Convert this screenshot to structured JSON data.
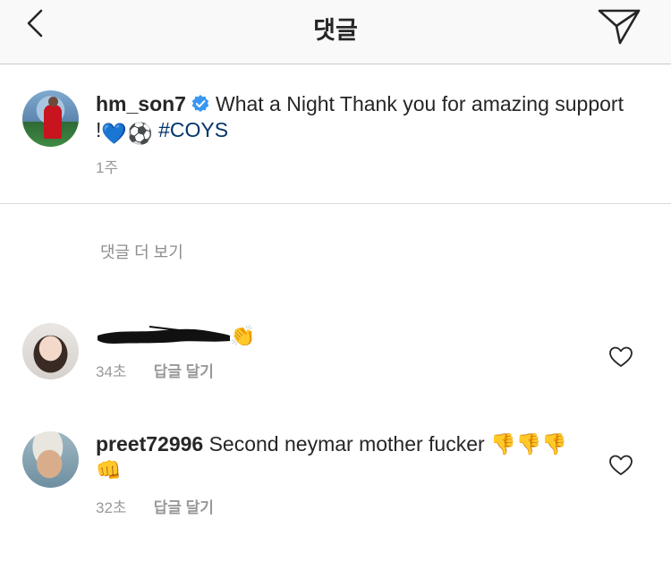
{
  "header": {
    "title": "댓글",
    "back_icon": "chevron-left-icon",
    "share_icon": "paper-plane-icon"
  },
  "caption": {
    "username": "hm_son7",
    "verified_icon": "verified-badge-icon",
    "text": "What a Night Thank you for amazing support !",
    "emojis": "💙⚽",
    "hashtag": "#COYS",
    "time": "1주"
  },
  "load_more": "댓글 더 보기",
  "comments": [
    {
      "username": "",
      "text": "👏",
      "time": "34초",
      "reply_label": "답글 달기",
      "like_icon": "heart-outline-icon"
    },
    {
      "username": "preet72996",
      "text": "Second neymar mother fucker 👎👎👎👊",
      "time": "32초",
      "reply_label": "답글 달기",
      "like_icon": "heart-outline-icon"
    }
  ],
  "colors": {
    "text": "#262626",
    "secondary": "#999999",
    "hashtag": "#003569",
    "verified": "#3897f0"
  }
}
